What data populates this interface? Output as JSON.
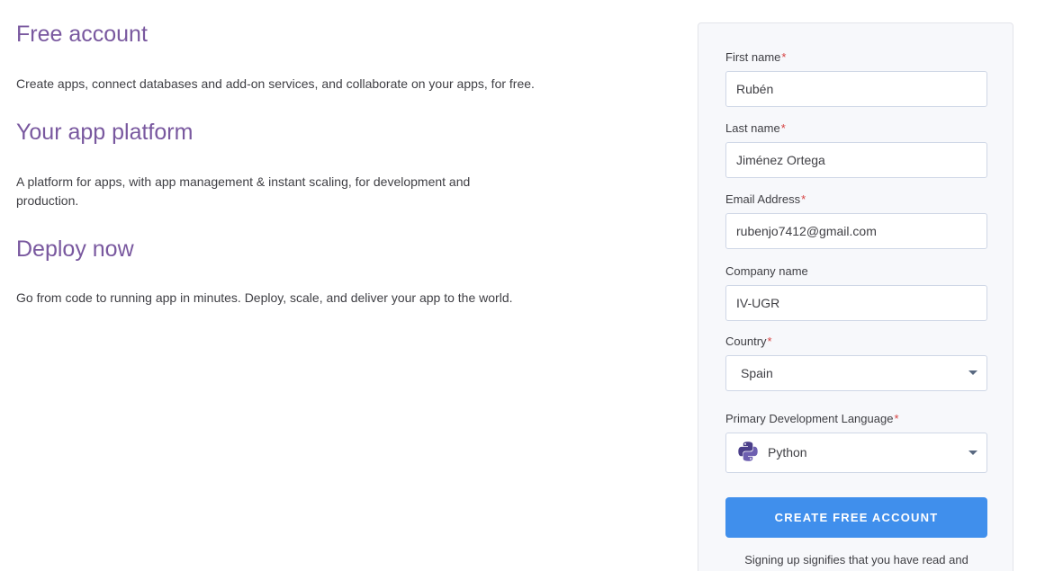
{
  "features": [
    {
      "title": "Free account",
      "text": "Create apps, connect databases and add-on services, and collaborate on your apps, for free."
    },
    {
      "title": "Your app platform",
      "text": "A platform for apps, with app management & instant scaling, for development and production."
    },
    {
      "title": "Deploy now",
      "text": "Go from code to running app in minutes. Deploy, scale, and deliver your app to the world."
    }
  ],
  "form": {
    "required_marker": "*",
    "first_name": {
      "label": "First name",
      "value": "Rubén"
    },
    "last_name": {
      "label": "Last name",
      "value": "Jiménez Ortega"
    },
    "email": {
      "label": "Email Address",
      "value": "rubenjo7412@gmail.com"
    },
    "company": {
      "label": "Company name",
      "value": "IV-UGR"
    },
    "country": {
      "label": "Country",
      "value": "Spain"
    },
    "language": {
      "label": "Primary Development Language",
      "value": "Python",
      "icon": "python-logo-icon"
    },
    "submit_label": "CREATE FREE ACCOUNT",
    "legal_text": "Signing up signifies that you have read and"
  },
  "colors": {
    "heading": "#79589f",
    "accent_button": "#408fec",
    "required": "#d64242",
    "panel_bg": "#f7f8fb"
  }
}
